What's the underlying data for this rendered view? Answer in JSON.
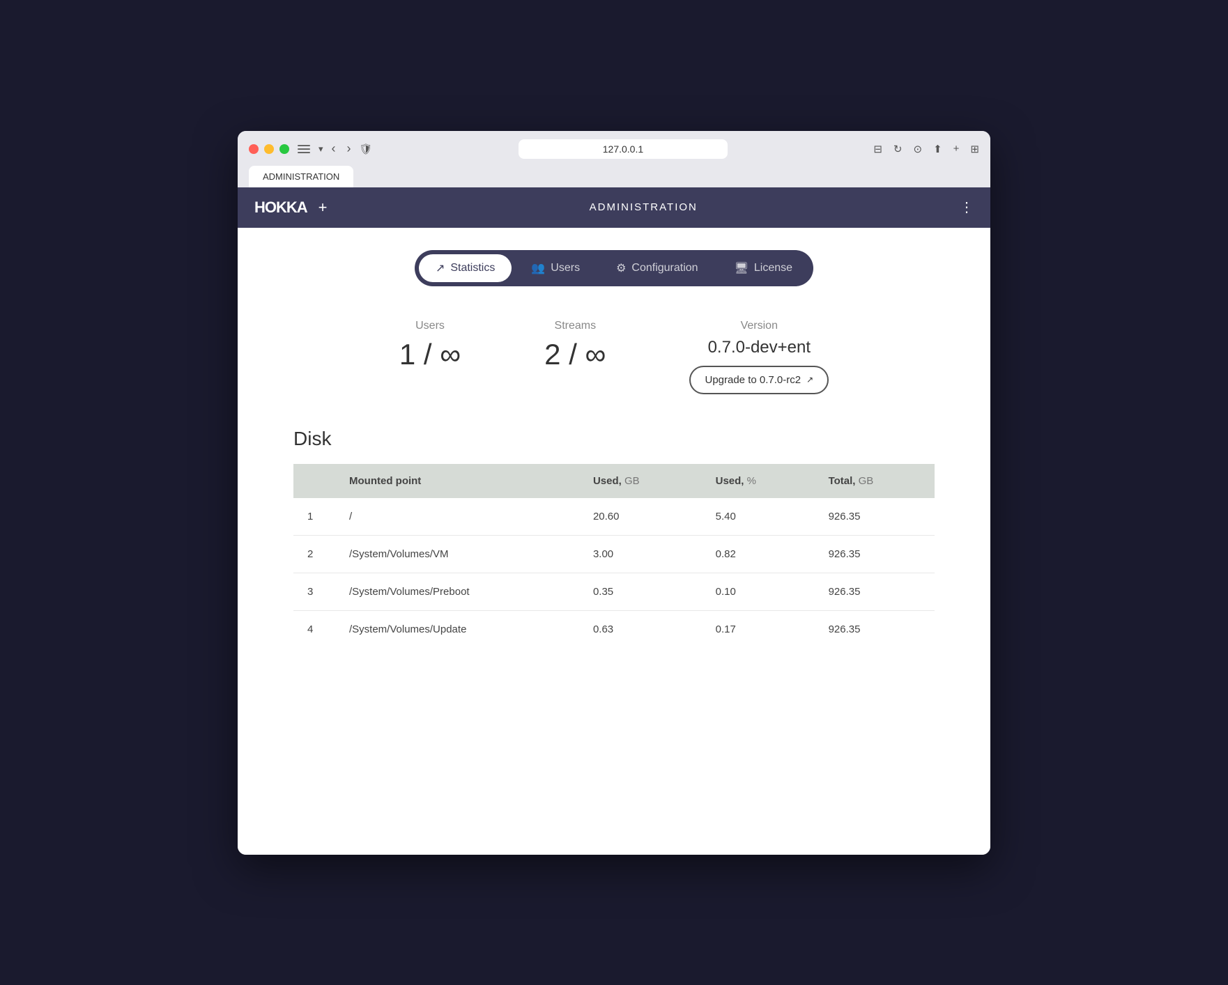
{
  "browser": {
    "url": "127.0.0.1",
    "tab_title": "ADMINISTRATION"
  },
  "header": {
    "logo": "HOKKA",
    "title": "ADMINISTRATION",
    "plus": "+",
    "dots": "⋮"
  },
  "tabs": [
    {
      "id": "statistics",
      "label": "Statistics",
      "icon": "📈",
      "active": true
    },
    {
      "id": "users",
      "label": "Users",
      "icon": "👥",
      "active": false
    },
    {
      "id": "configuration",
      "label": "Configuration",
      "icon": "⚙️",
      "active": false
    },
    {
      "id": "license",
      "label": "License",
      "icon": "🖥",
      "active": false
    }
  ],
  "stats": {
    "users": {
      "label": "Users",
      "value": "1 / ∞"
    },
    "streams": {
      "label": "Streams",
      "value": "2 / ∞"
    },
    "version": {
      "label": "Version",
      "value": "0.7.0-dev+ent",
      "upgrade_label": "Upgrade to 0.7.0-rc2",
      "upgrade_icon": "↗"
    }
  },
  "disk": {
    "section_title": "Disk",
    "columns": [
      {
        "id": "index",
        "label": ""
      },
      {
        "id": "mount",
        "label": "Mounted point",
        "unit": ""
      },
      {
        "id": "used_gb",
        "label": "Used,",
        "unit": "GB"
      },
      {
        "id": "used_pct",
        "label": "Used,",
        "unit": "%"
      },
      {
        "id": "total_gb",
        "label": "Total,",
        "unit": "GB"
      }
    ],
    "rows": [
      {
        "index": "1",
        "mount": "/",
        "used_gb": "20.60",
        "used_pct": "5.40",
        "total_gb": "926.35"
      },
      {
        "index": "2",
        "mount": "/System/Volumes/VM",
        "used_gb": "3.00",
        "used_pct": "0.82",
        "total_gb": "926.35"
      },
      {
        "index": "3",
        "mount": "/System/Volumes/Preboot",
        "used_gb": "0.35",
        "used_pct": "0.10",
        "total_gb": "926.35"
      },
      {
        "index": "4",
        "mount": "/System/Volumes/Update",
        "used_gb": "0.63",
        "used_pct": "0.17",
        "total_gb": "926.35"
      }
    ]
  }
}
